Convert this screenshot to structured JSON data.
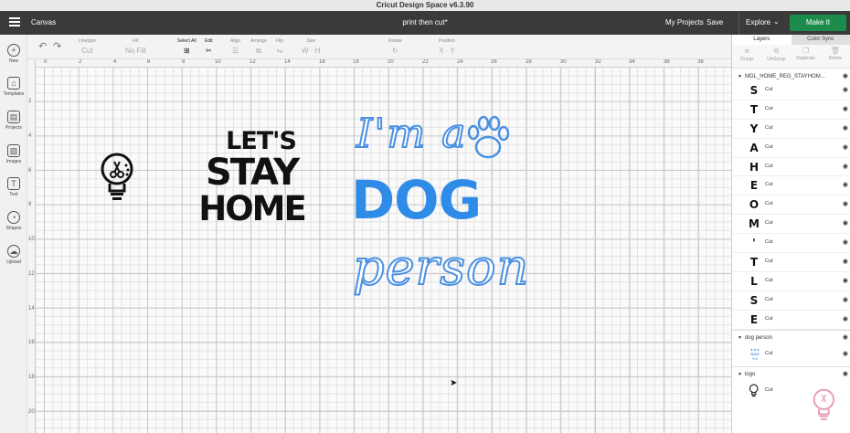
{
  "window": {
    "title": "Cricut Design Space  v6.3.90"
  },
  "header": {
    "app_name": "Canvas",
    "document_title": "print then cut*",
    "my_projects": "My Projects",
    "save": "Save",
    "explore": "Explore",
    "make_it": "Make It",
    "make_it_color": "#1c8c4c"
  },
  "toolbar": {
    "linetype": "Linetype",
    "linetype_value": "Cut",
    "fill": "Fill",
    "fill_value": "No Fill",
    "select_all": "Select All",
    "edit": "Edit",
    "align": "Align",
    "arrange": "Arrange",
    "flip": "Flip",
    "size": "Size",
    "size_w": "W",
    "size_h": "H",
    "rotate": "Rotate",
    "position": "Position",
    "position_x": "X",
    "position_y": "Y"
  },
  "sidebar": {
    "items": [
      {
        "label": "New",
        "icon": "plus-icon"
      },
      {
        "label": "Templates",
        "icon": "shirt-icon"
      },
      {
        "label": "Projects",
        "icon": "projects-icon"
      },
      {
        "label": "Images",
        "icon": "image-icon"
      },
      {
        "label": "Text",
        "icon": "text-icon"
      },
      {
        "label": "Shapes",
        "icon": "shapes-icon"
      },
      {
        "label": "Upload",
        "icon": "upload-icon"
      }
    ]
  },
  "rulers": {
    "top": [
      "0",
      "2",
      "4",
      "6",
      "8",
      "10",
      "12",
      "14",
      "16",
      "18",
      "20",
      "22",
      "24",
      "26",
      "28",
      "30",
      "32",
      "34",
      "36",
      "38"
    ],
    "left": [
      "2",
      "4",
      "6",
      "8",
      "10",
      "12",
      "14",
      "16",
      "18",
      "20"
    ]
  },
  "canvas": {
    "lets_stay_home": [
      "LET'S",
      "STAY",
      "HOME"
    ],
    "dog_person": [
      "I'm a",
      "DOG",
      "person"
    ],
    "dog_color": "#2f8be8",
    "outline_color": "#4a90e2"
  },
  "layers_panel": {
    "tabs": [
      "Layers",
      "Color Sync"
    ],
    "actions": [
      "Group",
      "UnGroup",
      "Duplicate",
      "Delete"
    ],
    "groups": [
      {
        "name": "MGL_HOME_REG_STAYHOM...",
        "layers": [
          {
            "thumb": "S",
            "label": "Cut"
          },
          {
            "thumb": "T",
            "label": "Cut"
          },
          {
            "thumb": "Y",
            "label": "Cut"
          },
          {
            "thumb": "A",
            "label": "Cut"
          },
          {
            "thumb": "H",
            "label": "Cut"
          },
          {
            "thumb": "E",
            "label": "Cut"
          },
          {
            "thumb": "O",
            "label": "Cut"
          },
          {
            "thumb": "M",
            "label": "Cut"
          },
          {
            "thumb": "'",
            "label": "Cut"
          },
          {
            "thumb": "T",
            "label": "Cut"
          },
          {
            "thumb": "L",
            "label": "Cut"
          },
          {
            "thumb": "S",
            "label": "Cut"
          },
          {
            "thumb": "E",
            "label": "Cut"
          }
        ]
      },
      {
        "name": "dog person",
        "layers": [
          {
            "label": "Cut"
          }
        ]
      },
      {
        "name": "logo",
        "layers": [
          {
            "label": "Cut"
          }
        ]
      }
    ]
  }
}
